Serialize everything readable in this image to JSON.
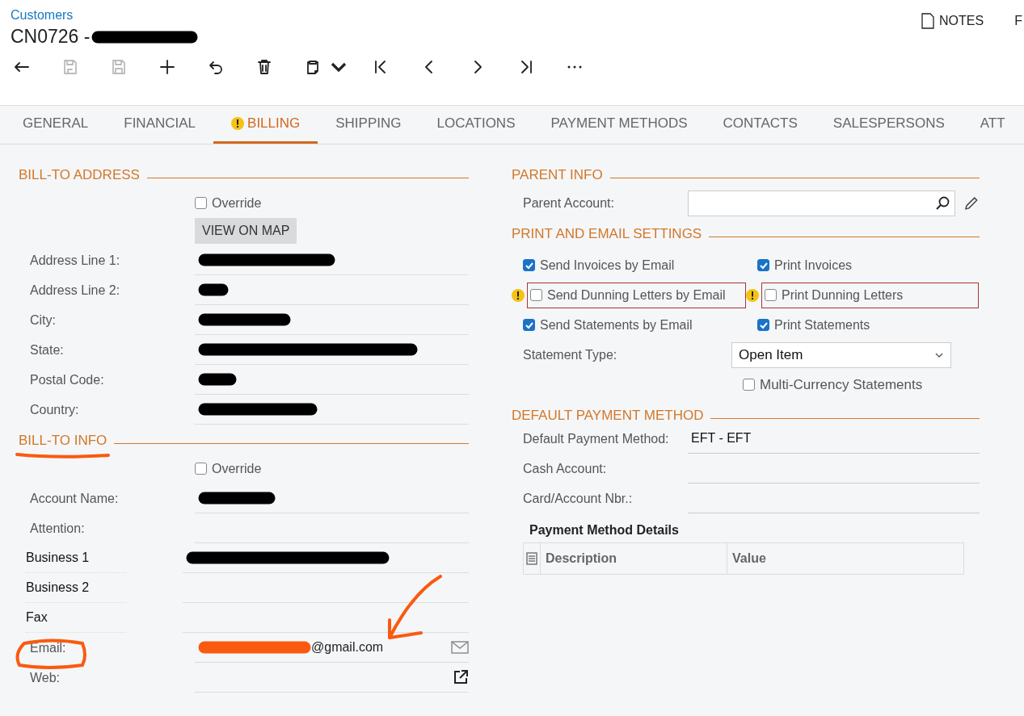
{
  "breadcrumb": "Customers",
  "title": {
    "text": "CN0726 -",
    "redacted": true,
    "color": "#000000"
  },
  "top_links": [
    {
      "label": "NOTES",
      "kind": "notes"
    },
    {
      "label": "F",
      "kind": "plain"
    }
  ],
  "toolbar": [
    {
      "disabled": false
    },
    {
      "disabled": true
    },
    {
      "disabled": true
    },
    {
      "disabled": false
    },
    {
      "disabled": false
    },
    {
      "disabled": false
    },
    {
      "disabled": false
    },
    {
      "disabled": false
    },
    {
      "disabled": false
    },
    {
      "disabled": false
    },
    {
      "disabled": false
    },
    {
      "disabled": false
    }
  ],
  "tabs": [
    {
      "label": "GENERAL",
      "selected": false,
      "warning": false
    },
    {
      "label": "FINANCIAL",
      "selected": false,
      "warning": false
    },
    {
      "label": "BILLING",
      "selected": true,
      "warning": true
    },
    {
      "label": "SHIPPING",
      "selected": false,
      "warning": false
    },
    {
      "label": "LOCATIONS",
      "selected": false,
      "warning": false
    },
    {
      "label": "PAYMENT METHODS",
      "selected": false,
      "warning": false
    },
    {
      "label": "CONTACTS",
      "selected": false,
      "warning": false
    },
    {
      "label": "SALESPERSONS",
      "selected": false,
      "warning": false
    },
    {
      "label": "ATT",
      "selected": false,
      "warning": false
    }
  ],
  "bill_to_address": {
    "title": "BILL-TO ADDRESS",
    "override": {
      "label": "Override",
      "checked": false
    },
    "map_button": "VIEW ON MAP",
    "fields": [
      {
        "label": "Address Line 1:",
        "redacted": true,
        "color": "#000000"
      },
      {
        "label": "Address Line 2:",
        "redacted": true,
        "color": "#000000"
      },
      {
        "label": "City:",
        "redacted": true,
        "color": "#000000"
      },
      {
        "label": "State:",
        "redacted": true,
        "color": "#000000"
      },
      {
        "label": "Postal Code:",
        "redacted": true,
        "color": "#000000"
      },
      {
        "label": "Country:",
        "redacted": true,
        "color": "#000000"
      }
    ]
  },
  "bill_to_info": {
    "title": "BILL-TO INFO",
    "override": {
      "label": "Override",
      "checked": false
    },
    "fields": [
      {
        "label": "Account Name:",
        "kind": "field",
        "redacted": true,
        "color": "#000000"
      },
      {
        "label": "Attention:",
        "kind": "field"
      },
      {
        "label": "Business 1",
        "kind": "contact",
        "redacted": true,
        "color": "#000000"
      },
      {
        "label": "Business 2",
        "kind": "contact"
      },
      {
        "label": "Fax",
        "kind": "contact"
      },
      {
        "label": "Email:",
        "kind": "email",
        "value": "@gmail.com",
        "redacted": true,
        "color": "#fa5a0f"
      },
      {
        "label": "Web:",
        "kind": "web"
      }
    ]
  },
  "parent_info": {
    "title": "PARENT INFO",
    "parent_account": {
      "label": "Parent Account:"
    }
  },
  "print_email": {
    "title": "PRINT AND EMAIL SETTINGS",
    "options": [
      {
        "label": "Send Invoices by Email",
        "checked": true,
        "warning": false
      },
      {
        "label": "Print Invoices",
        "checked": true,
        "warning": false
      },
      {
        "label": "Send Dunning Letters by Email",
        "checked": false,
        "warning": true
      },
      {
        "label": "Print Dunning Letters",
        "checked": false,
        "warning": true
      },
      {
        "label": "Send Statements by Email",
        "checked": true,
        "warning": false
      },
      {
        "label": "Print Statements",
        "checked": true,
        "warning": false
      }
    ],
    "statement_type": {
      "label": "Statement Type:",
      "value": "Open Item"
    },
    "multi_currency": {
      "label": "Multi-Currency Statements",
      "checked": false
    }
  },
  "default_payment": {
    "title": "DEFAULT PAYMENT METHOD",
    "fields": [
      {
        "label": "Default Payment Method:",
        "value": "EFT - EFT"
      },
      {
        "label": "Cash Account:"
      },
      {
        "label": "Card/Account Nbr.:"
      }
    ],
    "details": {
      "title": "Payment Method Details",
      "columns": [
        "Description",
        "Value"
      ]
    }
  },
  "annotations": [
    {
      "kind": "underline"
    },
    {
      "kind": "circle"
    },
    {
      "kind": "arrow"
    }
  ]
}
